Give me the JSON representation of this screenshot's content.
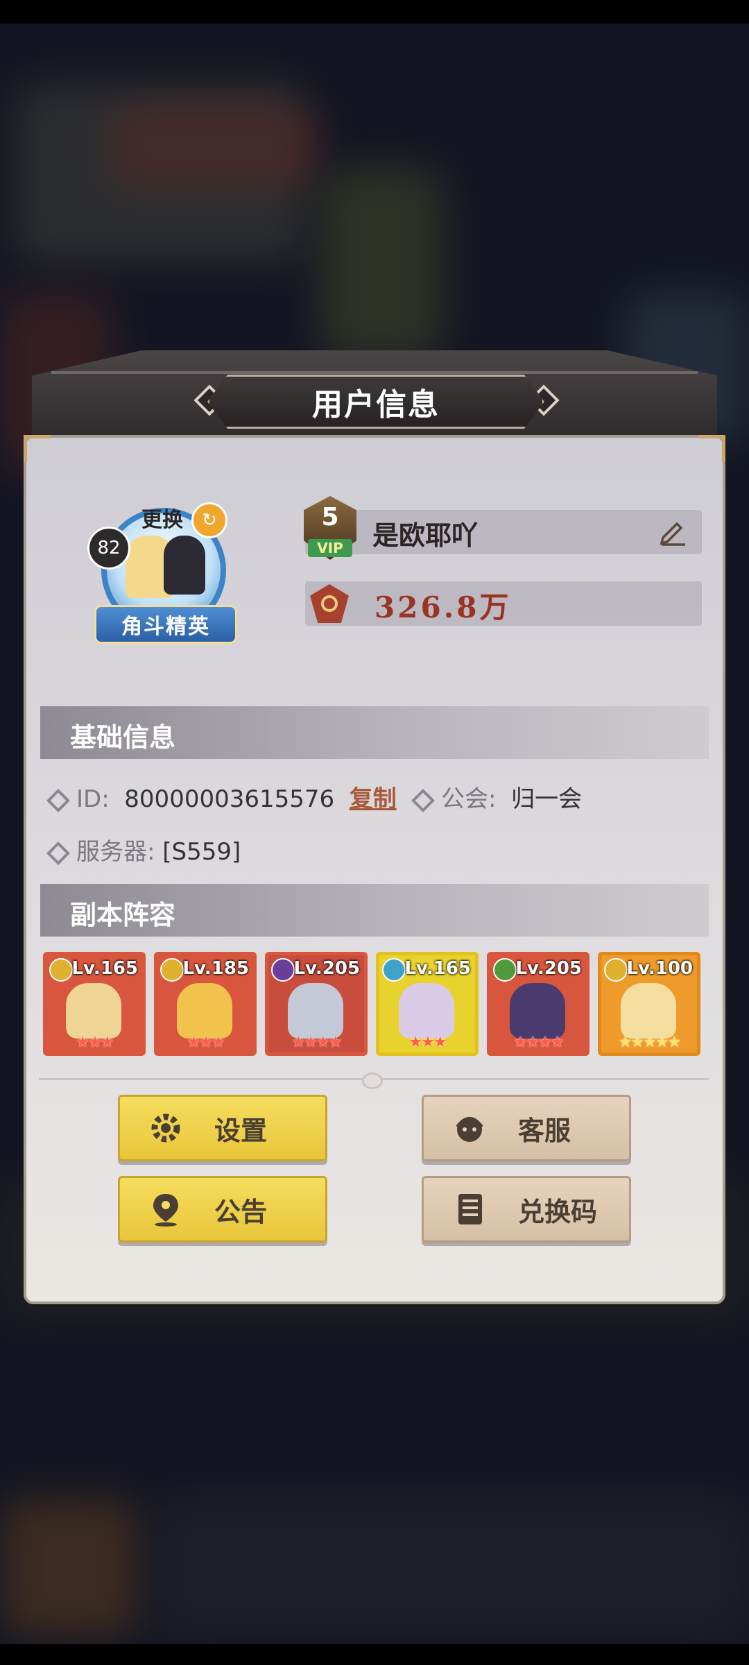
{
  "dialog": {
    "title": "用户信息"
  },
  "profile": {
    "level": "82",
    "change_label": "更换",
    "rank": "角斗精英",
    "vip_level": "5",
    "vip_text": "VIP",
    "name": "是欧耶吖",
    "power": "326.8万"
  },
  "basic_info": {
    "header": "基础信息",
    "id_label": "ID:",
    "id_value": "80000003615576",
    "copy_label": "复制",
    "guild_label": "公会:",
    "guild_value": "归一会",
    "server_label": "服务器:",
    "server_value": "[S559]"
  },
  "lineup": {
    "header": "副本阵容",
    "heroes": [
      {
        "level": "Lv.165",
        "stars": "★★★",
        "element": "gold",
        "bg": "#d9563e",
        "fig": "#f0d495"
      },
      {
        "level": "Lv.185",
        "stars": "★★★",
        "element": "gold",
        "bg": "#d9563e",
        "fig": "#f1c24c"
      },
      {
        "level": "Lv.205",
        "stars": "★★★★",
        "element": "purple",
        "bg": "#c94d3c",
        "fig": "#c5c8d6"
      },
      {
        "level": "Lv.165",
        "stars": "★★★",
        "element": "cyan",
        "bg": "#e8d22d",
        "fig": "#d9cbe5"
      },
      {
        "level": "Lv.205",
        "stars": "★★★★",
        "element": "green",
        "bg": "#d9563e",
        "fig": "#4b3a6e"
      },
      {
        "level": "Lv.100",
        "stars": "★★★★★",
        "element": "gold",
        "bg": "#ef9b2c",
        "fig": "#f3dd9f"
      }
    ]
  },
  "buttons": {
    "settings": "设置",
    "service": "客服",
    "notice": "公告",
    "redeem": "兑换码"
  },
  "colors": {
    "accent_red": "#9a3324",
    "button_yellow": "#f5dd5e",
    "button_beige": "#e7d3bd"
  }
}
